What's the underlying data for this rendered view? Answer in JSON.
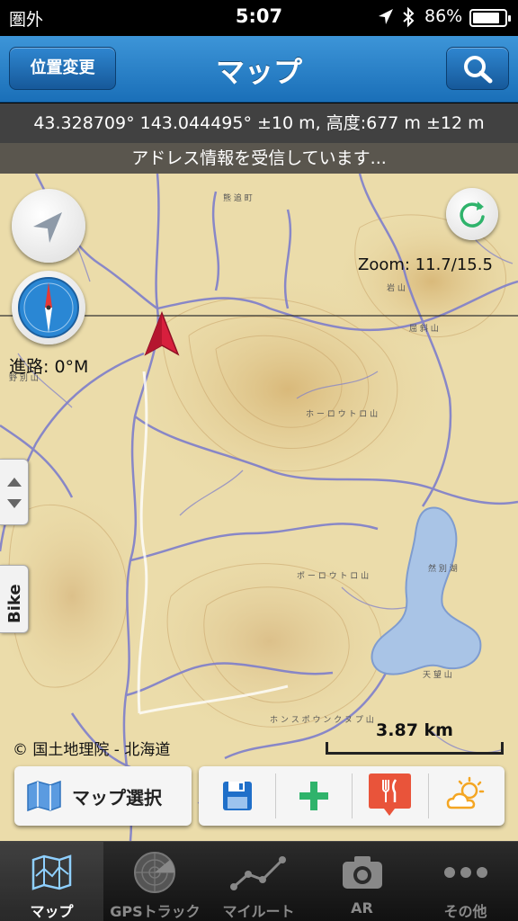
{
  "status_bar": {
    "carrier": "圏外",
    "time": "5:07",
    "battery_percent": "86%",
    "battery_level": 0.86,
    "icons": [
      "location-arrow-icon",
      "bluetooth-icon",
      "battery-icon"
    ]
  },
  "nav": {
    "left_button": "位置変更",
    "title": "マップ",
    "right_icon": "search-icon"
  },
  "coords_text": "43.328709° 143.044495° ±10 m, 高度:677 m ±12 m",
  "address_text": "アドレス情報を受信しています...",
  "map": {
    "zoom_text": "Zoom: 11.7/15.5",
    "heading_text": "進路: 0°M",
    "copyright_text": "© 国土地理院 - 北海道",
    "scale_text": "3.87 km",
    "bike_tab": "Bike",
    "lake_color": "#a9c4e6",
    "terrain_color": "#ead9a6",
    "river_color": "#7e7ecb"
  },
  "toolbar": {
    "map_select_label": "マップ選択",
    "icons": [
      "map-icon",
      "save-icon",
      "add-icon",
      "restaurant-icon",
      "weather-icon"
    ]
  },
  "tabs": [
    {
      "label": "マップ",
      "icon": "map-tab-icon",
      "active": true
    },
    {
      "label": "GPSトラック",
      "icon": "radar-icon",
      "active": false
    },
    {
      "label": "マイルート",
      "icon": "route-icon",
      "active": false
    },
    {
      "label": "AR",
      "icon": "camera-icon",
      "active": false
    },
    {
      "label": "その他",
      "icon": "more-icon",
      "active": false
    }
  ],
  "colors": {
    "nav_blue": "#1a6fb8",
    "add_green": "#2fb36b",
    "restaurant_red": "#e9543a",
    "weather_yellow": "#f4a623",
    "save_blue": "#1f6fc9",
    "compass_blue": "#2a87d4",
    "arrow_red": "#d81f3d"
  }
}
